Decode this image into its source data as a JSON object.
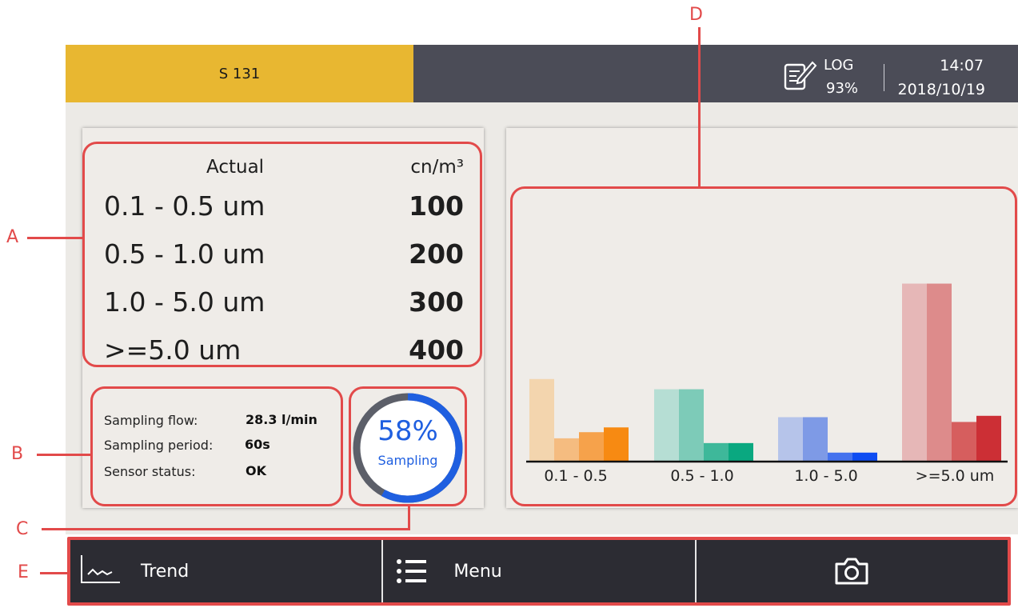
{
  "header": {
    "device_name": "S 131",
    "log_label": "LOG",
    "log_percent": "93%",
    "time": "14:07",
    "date": "2018/10/19",
    "colors": {
      "tab": "#e8b731",
      "bar": "#4b4c57"
    }
  },
  "readings": {
    "header_label": "Actual",
    "unit": "cn/m³",
    "rows": [
      {
        "range": "0.1 - 0.5 um",
        "value": "100"
      },
      {
        "range": "0.5 - 1.0 um",
        "value": "200"
      },
      {
        "range": "1.0 - 5.0 um",
        "value": "300"
      },
      {
        "range": ">=5.0 um",
        "value": "400"
      }
    ]
  },
  "sampling": {
    "flow_label": "Sampling flow:",
    "flow_value": "28.3 l/min",
    "period_label": "Sampling period:",
    "period_value": "60s",
    "status_label": "Sensor status:",
    "status_value": "OK"
  },
  "progress": {
    "percent_text": "58%",
    "progress_fraction": 0.58,
    "label": "Sampling",
    "color": "#1f5fe0"
  },
  "chart_data": {
    "type": "bar",
    "categories": [
      "0.1 - 0.5",
      "0.5 - 1.0",
      "1.0 - 5.0",
      ">=5.0 um"
    ],
    "ylim": [
      0,
      270
    ],
    "groups": [
      {
        "colors": [
          "#f3d5ae",
          "#f5bc80",
          "#f6a24b",
          "#f78a12"
        ],
        "values": [
          120,
          33,
          42,
          49
        ]
      },
      {
        "colors": [
          "#b6ded4",
          "#7dcbb8",
          "#3eb89a",
          "#0aa880"
        ],
        "values": [
          105,
          105,
          26,
          26
        ]
      },
      {
        "colors": [
          "#b6c4ea",
          "#7e9ae6",
          "#4472ee",
          "#0e4cf2"
        ],
        "values": [
          64,
          64,
          12,
          12
        ]
      },
      {
        "colors": [
          "#e6b7b7",
          "#dd8b8b",
          "#d65e5e",
          "#cc2f35"
        ],
        "values": [
          260,
          260,
          57,
          66
        ]
      }
    ],
    "grid": false
  },
  "annotations": {
    "a": "A",
    "b": "B",
    "c": "C",
    "d": "D",
    "e": "E"
  },
  "bottom_bar": {
    "trend_label": "Trend",
    "menu_label": "Menu"
  }
}
